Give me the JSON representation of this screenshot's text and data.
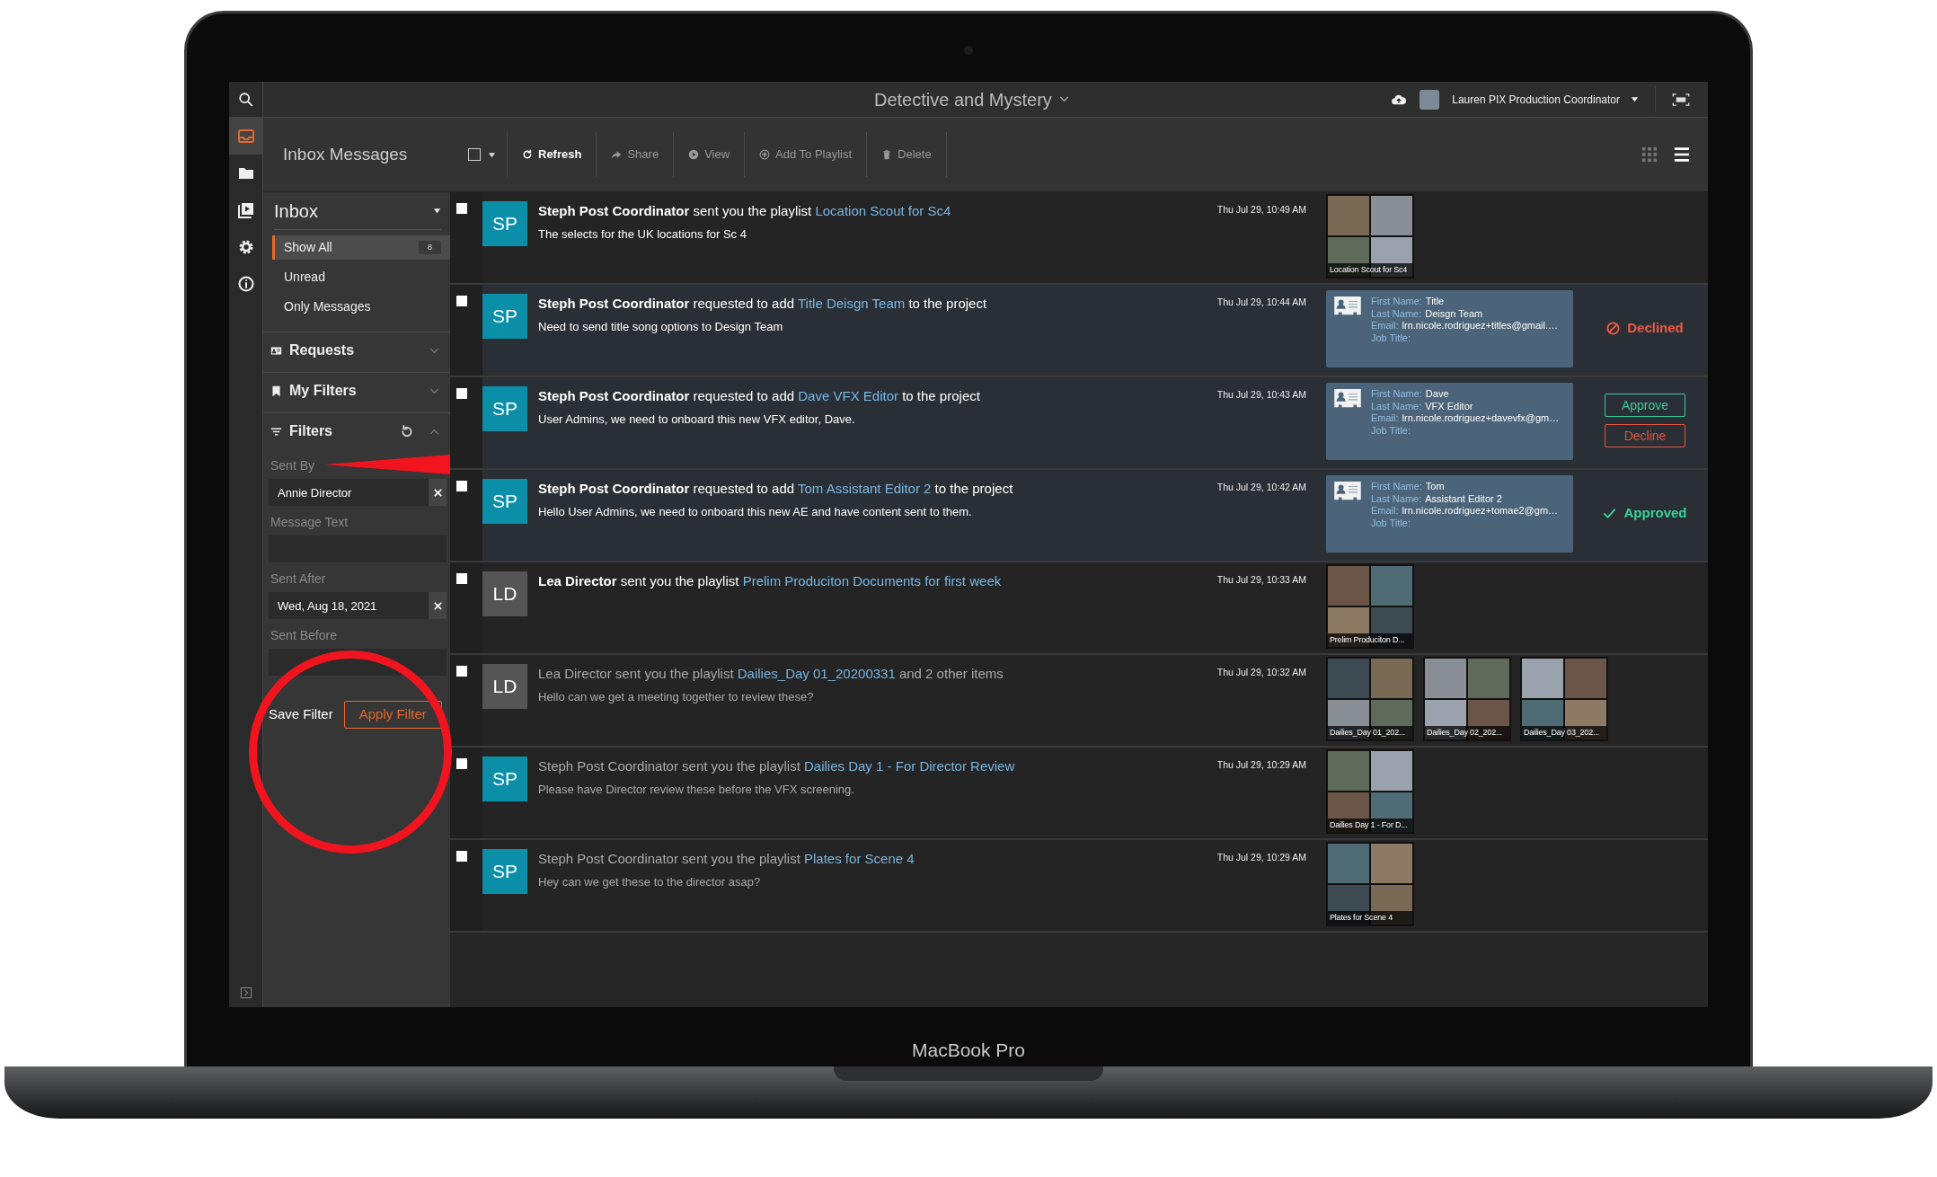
{
  "device": {
    "label": "MacBook Pro"
  },
  "rail": [
    {
      "kind": "search",
      "selected": false
    },
    {
      "kind": "inbox",
      "selected": true
    },
    {
      "kind": "folder",
      "selected": false
    },
    {
      "kind": "media",
      "selected": false
    },
    {
      "kind": "settings",
      "selected": false
    },
    {
      "kind": "info",
      "selected": false
    }
  ],
  "top_bar": {
    "title": "Detective and Mystery",
    "user": "Lauren PIX Production Coordinator"
  },
  "toolbar": {
    "title": "Inbox Messages",
    "select_all": {
      "checked": false
    },
    "actions": [
      {
        "kind": "refresh",
        "label": "Refresh",
        "disabled": false
      },
      {
        "kind": "share",
        "label": "Share",
        "disabled": true
      },
      {
        "kind": "view",
        "label": "View",
        "disabled": true
      },
      {
        "kind": "add",
        "label": "Add To Playlist",
        "disabled": true
      },
      {
        "kind": "delete",
        "label": "Delete",
        "disabled": true
      }
    ]
  },
  "sidebar": {
    "header": "Inbox",
    "views": [
      {
        "label": "Show All",
        "selected": true,
        "count": "8"
      },
      {
        "label": "Unread",
        "selected": false
      },
      {
        "label": "Only Messages",
        "selected": false
      }
    ],
    "sections": [
      {
        "kind": "requests",
        "label": "Requests",
        "expanded": false
      },
      {
        "kind": "bookmark",
        "label": "My Filters",
        "expanded": false
      },
      {
        "kind": "filters",
        "label": "Filters",
        "expanded": true
      }
    ],
    "filters": [
      {
        "label": "Sent By",
        "value": "Annie Director"
      },
      {
        "label": "Message Text"
      },
      {
        "label": "Sent After",
        "value": "Wed, Aug 18, 2021"
      },
      {
        "label": "Sent Before"
      }
    ],
    "save": "Save Filter",
    "apply": "Apply Filter"
  },
  "messages": [
    {
      "kind": "playlist",
      "unread": true,
      "checked": false,
      "avatar": "SP",
      "color": "#0b8fa8",
      "sender": "Steph Post Coordinator",
      "verb": "sent you the playlist",
      "link": "Location Scout for Sc4",
      "body": "The selects for the UK locations for Sc 4",
      "time": "Thu Jul 29, 10:49 AM",
      "thumbnails": [
        {
          "caption": "Location Scout for Sc4"
        }
      ]
    },
    {
      "kind": "request",
      "unread": true,
      "checked": false,
      "avatar": "SP",
      "color": "#0b8fa8",
      "sender": "Steph Post Coordinator",
      "verb": "requested to add",
      "link": "Title Deisgn Team",
      "tail": "to the project",
      "body": "Need to send title song options to Design Team",
      "time": "Thu Jul 29, 10:44 AM",
      "card": [
        {
          "label": "First Name:",
          "value": "Title"
        },
        {
          "label": "Last Name:",
          "value": "Deisgn Team"
        },
        {
          "label": "Email:",
          "value": "lrn.nicole.rodriguez+titles@gmail.…"
        },
        {
          "label": "Job Title:"
        }
      ],
      "status": {
        "kind": "declined",
        "label": "Declined"
      }
    },
    {
      "kind": "request",
      "unread": true,
      "checked": false,
      "avatar": "SP",
      "color": "#0b8fa8",
      "sender": "Steph Post Coordinator",
      "verb": "requested to add",
      "link": "Dave VFX Editor",
      "tail": "to the project",
      "body": "User Admins, we need to onboard this new VFX editor, Dave.",
      "time": "Thu Jul 29, 10:43 AM",
      "card": [
        {
          "label": "First Name:",
          "value": "Dave"
        },
        {
          "label": "Last Name:",
          "value": "VFX Editor"
        },
        {
          "label": "Email:",
          "value": "lrn.nicole.rodriguez+davevfx@gm…"
        },
        {
          "label": "Job Title:"
        }
      ],
      "status": {
        "kind": "pending",
        "actions": [
          {
            "kind": "approve",
            "label": "Approve"
          },
          {
            "kind": "decline",
            "label": "Decline"
          }
        ]
      }
    },
    {
      "kind": "request",
      "unread": true,
      "checked": false,
      "avatar": "SP",
      "color": "#0b8fa8",
      "sender": "Steph Post Coordinator",
      "verb": "requested to add",
      "link": "Tom Assistant Editor 2",
      "tail": "to the project",
      "body": "Hello User Admins, we need to onboard this new AE and have content sent to them.",
      "time": "Thu Jul 29, 10:42 AM",
      "card": [
        {
          "label": "First Name:",
          "value": "Tom"
        },
        {
          "label": "Last Name:",
          "value": "Assistant Editor 2"
        },
        {
          "label": "Email:",
          "value": "lrn.nicole.rodriguez+tomae2@gm…"
        },
        {
          "label": "Job Title:"
        }
      ],
      "status": {
        "kind": "approved",
        "label": "Approved"
      }
    },
    {
      "kind": "playlist",
      "unread": true,
      "checked": false,
      "avatar": "LD",
      "color": "#555555",
      "sender": "Lea Director",
      "verb": "sent you the playlist",
      "link": "Prelim Produciton Documents for first week",
      "time": "Thu Jul 29, 10:33 AM",
      "thumbnails": [
        {
          "caption": "Prelim Produciton D..."
        }
      ]
    },
    {
      "kind": "playlist",
      "unread": false,
      "checked": false,
      "avatar": "LD",
      "color": "#555555",
      "sender": "Lea Director",
      "verb": "sent you the playlist",
      "link": "Dailies_Day 01_20200331",
      "tail": "and 2 other items",
      "body": "Hello can we get a meeting together to review these?",
      "time": "Thu Jul 29, 10:32 AM",
      "thumbnails": [
        {
          "caption": "Dailies_Day 01_202..."
        },
        {
          "caption": "Dailies_Day 02_202..."
        },
        {
          "caption": "Dailies_Day 03_202..."
        }
      ]
    },
    {
      "kind": "playlist",
      "unread": false,
      "checked": false,
      "avatar": "SP",
      "color": "#0b8fa8",
      "sender": "Steph Post Coordinator",
      "verb": "sent you the playlist",
      "link": "Dailies Day 1 - For Director Review",
      "body": "Please have Director review these before the VFX screening.",
      "time": "Thu Jul 29, 10:29 AM",
      "thumbnails": [
        {
          "caption": "Dailies Day 1 - For D..."
        }
      ]
    },
    {
      "kind": "playlist",
      "unread": false,
      "checked": false,
      "avatar": "SP",
      "color": "#0b8fa8",
      "sender": "Steph Post Coordinator",
      "verb": "sent you the playlist",
      "link": "Plates for Scene 4",
      "body": "Hey can we get these to the director asap?",
      "time": "Thu Jul 29, 10:29 AM",
      "thumbnails": [
        {
          "caption": "Plates for Scene 4"
        }
      ]
    }
  ]
}
